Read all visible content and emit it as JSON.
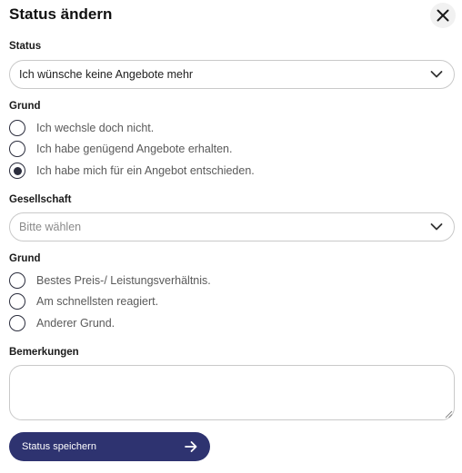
{
  "dialog": {
    "title": "Status ändern",
    "close_icon": "close-icon"
  },
  "status": {
    "label": "Status",
    "value": "Ich wünsche keine Angebote mehr",
    "icon": "chevron-down-icon"
  },
  "reason": {
    "label": "Grund",
    "options": [
      {
        "label": "Ich wechsle doch nicht.",
        "selected": false
      },
      {
        "label": "Ich habe genügend Angebote erhalten.",
        "selected": false
      },
      {
        "label": "Ich habe mich für ein Angebot entschieden.",
        "selected": true
      }
    ]
  },
  "company": {
    "label": "Gesellschaft",
    "placeholder": "Bitte wählen",
    "icon": "chevron-down-icon"
  },
  "company_reason": {
    "label": "Grund",
    "options": [
      {
        "label": "Bestes Preis-/ Leistungsverhältnis.",
        "selected": false
      },
      {
        "label": "Am schnellsten reagiert.",
        "selected": false
      },
      {
        "label": "Anderer Grund.",
        "selected": false
      }
    ]
  },
  "remarks": {
    "label": "Bemerkungen",
    "value": ""
  },
  "submit": {
    "label": "Status speichern",
    "icon": "arrow-right-icon"
  },
  "colors": {
    "primary": "#2e3370",
    "radio_border": "#2b2d3d"
  }
}
